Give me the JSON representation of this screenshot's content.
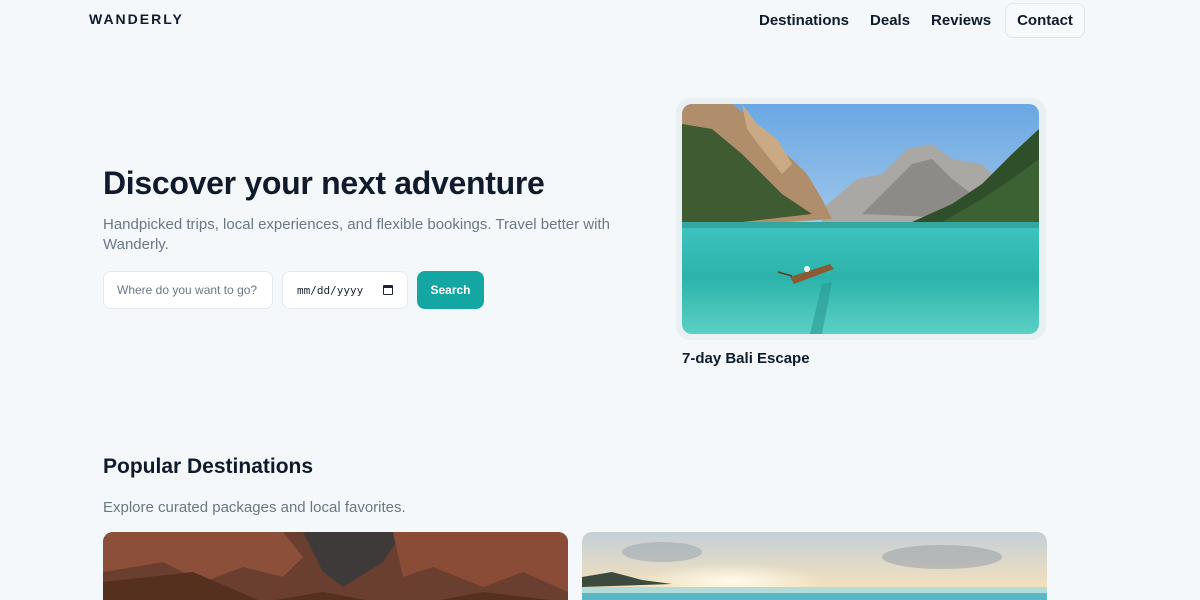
{
  "nav": {
    "brand": "WANDERLY",
    "links": [
      "Destinations",
      "Deals",
      "Reviews"
    ],
    "contact": "Contact"
  },
  "hero": {
    "title": "Discover your next adventure",
    "subtitle": "Handpicked trips, local experiences, and flexible bookings. Travel better with Wanderly.",
    "search": {
      "destination_placeholder": "Where do you want to go?",
      "date_value": "mm/dd/yyyy",
      "button": "Search"
    }
  },
  "featured": {
    "caption": "7-day Bali Escape",
    "image": "mountain-lake-landscape"
  },
  "popular": {
    "title": "Popular Destinations",
    "subtitle": "Explore curated packages and local favorites.",
    "cards": [
      {
        "image": "red-canyon-landscape"
      },
      {
        "image": "beach-sunset-landscape"
      }
    ]
  },
  "colors": {
    "accent": "#14a6a2",
    "text": "#0f1b2d",
    "muted": "#6b7785",
    "background": "#f4f8fb"
  }
}
